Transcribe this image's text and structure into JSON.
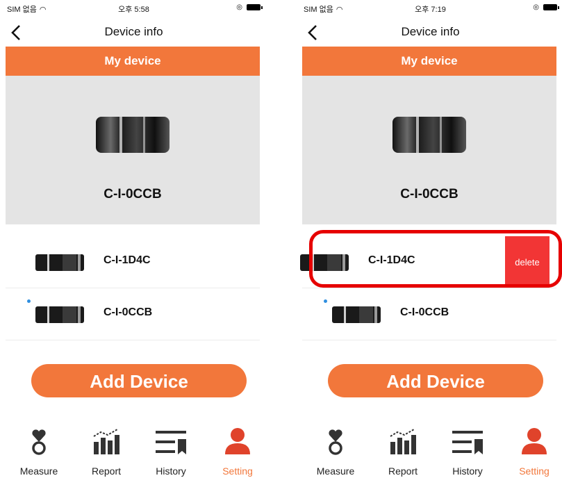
{
  "screens": [
    {
      "status": {
        "carrier": "SIM 없음",
        "time": "오후 5:58"
      },
      "title": "Device info",
      "my_device_label": "My device",
      "current_device": "C-I-0CCB",
      "devices": [
        {
          "name": "C-I-1D4C",
          "connected": false
        },
        {
          "name": "C-I-0CCB",
          "connected": true
        }
      ],
      "add_button": "Add Device",
      "tabs": [
        {
          "label": "Measure",
          "icon": "heart-ring-icon",
          "active": false
        },
        {
          "label": "Report",
          "icon": "bar-chart-icon",
          "active": false
        },
        {
          "label": "History",
          "icon": "list-bookmark-icon",
          "active": false
        },
        {
          "label": "Setting",
          "icon": "person-icon",
          "active": true
        }
      ]
    },
    {
      "status": {
        "carrier": "SIM 없음",
        "time": "오후 7:19"
      },
      "title": "Device info",
      "my_device_label": "My device",
      "current_device": "C-I-0CCB",
      "devices": [
        {
          "name": "C-I-1D4C",
          "connected": false,
          "swiped": true
        },
        {
          "name": "C-I-0CCB",
          "connected": true
        }
      ],
      "delete_label": "delete",
      "add_button": "Add Device",
      "tabs": [
        {
          "label": "Measure",
          "icon": "heart-ring-icon",
          "active": false
        },
        {
          "label": "Report",
          "icon": "bar-chart-icon",
          "active": false
        },
        {
          "label": "History",
          "icon": "list-bookmark-icon",
          "active": false
        },
        {
          "label": "Setting",
          "icon": "person-icon",
          "active": true
        }
      ]
    }
  ],
  "colors": {
    "accent": "#f2773b",
    "delete": "#f23535",
    "highlight": "#e60000",
    "connected_dot": "#2f8fe0"
  }
}
